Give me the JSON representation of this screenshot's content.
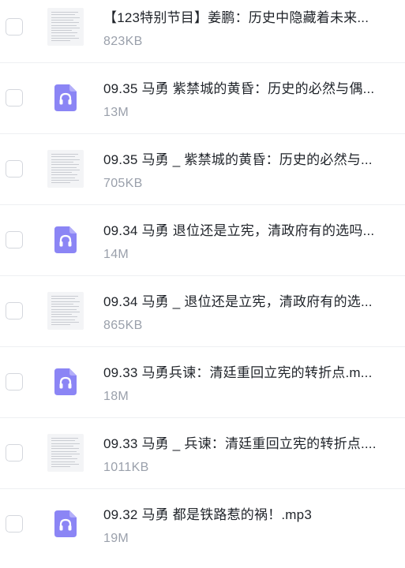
{
  "files": [
    {
      "name": "【123特别节目】姜鹏：历史中隐藏着未来...",
      "size": "823KB",
      "type": "doc",
      "icon": "document-thumbnail-icon"
    },
    {
      "name": "09.35 马勇 紫禁城的黄昏：历史的必然与偶...",
      "size": "13M",
      "type": "audio",
      "icon": "headphones-icon"
    },
    {
      "name": "09.35 马勇 _ 紫禁城的黄昏：历史的必然与...",
      "size": "705KB",
      "type": "doc",
      "icon": "document-thumbnail-icon"
    },
    {
      "name": "09.34 马勇 退位还是立宪，清政府有的选吗...",
      "size": "14M",
      "type": "audio",
      "icon": "headphones-icon"
    },
    {
      "name": "09.34 马勇 _ 退位还是立宪，清政府有的选...",
      "size": "865KB",
      "type": "doc",
      "icon": "document-thumbnail-icon"
    },
    {
      "name": "09.33 马勇兵谏：清廷重回立宪的转折点.m...",
      "size": "18M",
      "type": "audio",
      "icon": "headphones-icon"
    },
    {
      "name": "09.33 马勇 _ 兵谏：清廷重回立宪的转折点....",
      "size": "1011KB",
      "type": "doc",
      "icon": "document-thumbnail-icon"
    },
    {
      "name": "09.32 马勇 都是铁路惹的祸！.mp3",
      "size": "19M",
      "type": "audio",
      "icon": "headphones-icon"
    }
  ],
  "colors": {
    "audio_icon": "#8b85f5",
    "audio_icon_fold": "#b3aefa",
    "size_text": "#9aa0ab",
    "divider": "#eef0f3",
    "checkbox_border": "#d4d7dd"
  }
}
